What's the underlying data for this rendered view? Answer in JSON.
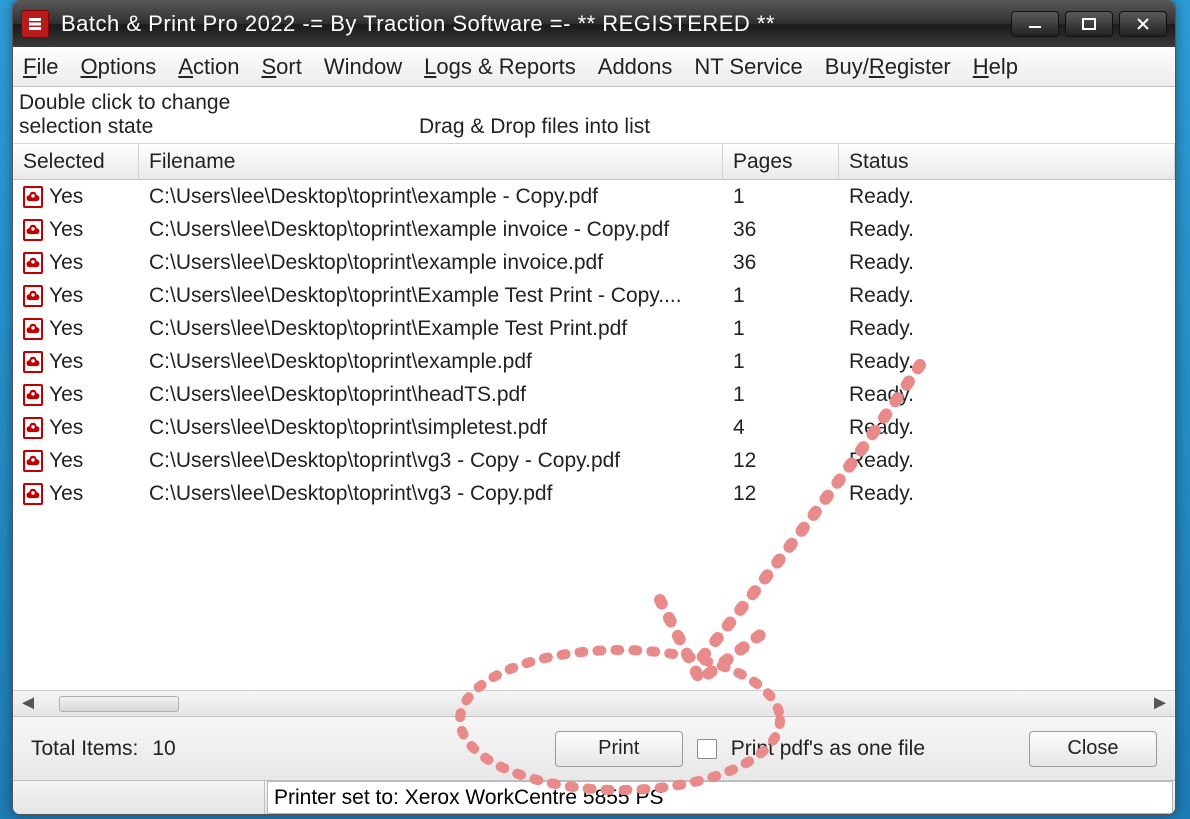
{
  "window": {
    "title": "Batch & Print Pro 2022 -= By Traction Software =- ** REGISTERED **"
  },
  "menubar": {
    "items": [
      {
        "label": "File",
        "u": 0
      },
      {
        "label": "Options",
        "u": 0
      },
      {
        "label": "Action",
        "u": 0
      },
      {
        "label": "Sort",
        "u": 0
      },
      {
        "label": "Window",
        "u": -1
      },
      {
        "label": "Logs & Reports",
        "u": 0
      },
      {
        "label": "Addons",
        "u": -1
      },
      {
        "label": "NT Service",
        "u": -1
      },
      {
        "label": "Buy/Register",
        "u": 4
      },
      {
        "label": "Help",
        "u": 0
      }
    ]
  },
  "hints": {
    "double_click": "Double click to change selection state",
    "drag_drop": "Drag & Drop files into list"
  },
  "columns": {
    "selected": "Selected",
    "filename": "Filename",
    "pages": "Pages",
    "status": "Status"
  },
  "rows": [
    {
      "selected": "Yes",
      "filename": "C:\\Users\\lee\\Desktop\\toprint\\example - Copy.pdf",
      "pages": "1",
      "status": "Ready."
    },
    {
      "selected": "Yes",
      "filename": "C:\\Users\\lee\\Desktop\\toprint\\example invoice - Copy.pdf",
      "pages": "36",
      "status": "Ready."
    },
    {
      "selected": "Yes",
      "filename": "C:\\Users\\lee\\Desktop\\toprint\\example invoice.pdf",
      "pages": "36",
      "status": "Ready."
    },
    {
      "selected": "Yes",
      "filename": "C:\\Users\\lee\\Desktop\\toprint\\Example Test Print - Copy....",
      "pages": "1",
      "status": "Ready."
    },
    {
      "selected": "Yes",
      "filename": "C:\\Users\\lee\\Desktop\\toprint\\Example Test Print.pdf",
      "pages": "1",
      "status": "Ready."
    },
    {
      "selected": "Yes",
      "filename": "C:\\Users\\lee\\Desktop\\toprint\\example.pdf",
      "pages": "1",
      "status": "Ready."
    },
    {
      "selected": "Yes",
      "filename": "C:\\Users\\lee\\Desktop\\toprint\\headTS.pdf",
      "pages": "1",
      "status": "Ready."
    },
    {
      "selected": "Yes",
      "filename": "C:\\Users\\lee\\Desktop\\toprint\\simpletest.pdf",
      "pages": "4",
      "status": "Ready."
    },
    {
      "selected": "Yes",
      "filename": "C:\\Users\\lee\\Desktop\\toprint\\vg3 - Copy - Copy.pdf",
      "pages": "12",
      "status": "Ready."
    },
    {
      "selected": "Yes",
      "filename": "C:\\Users\\lee\\Desktop\\toprint\\vg3 - Copy.pdf",
      "pages": "12",
      "status": "Ready."
    }
  ],
  "footer": {
    "total_label": "Total Items:",
    "total_value": "10",
    "print_btn": "Print",
    "print_one_file": "Print pdf's as one file",
    "close_btn": "Close"
  },
  "status": {
    "printer": "Printer set to: Xerox WorkCentre 5855 PS"
  },
  "annotation": {
    "arrow_stroke": "#e98a8a",
    "circle_stroke": "#e98a8a"
  }
}
